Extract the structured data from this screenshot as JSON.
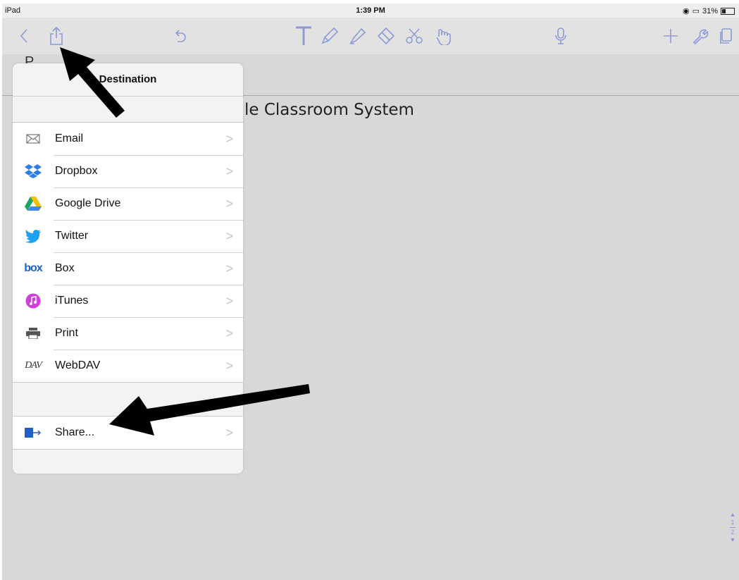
{
  "status_bar": {
    "device": "iPad",
    "time": "1:39 PM",
    "battery": "31%"
  },
  "document": {
    "title_fragment": "le Classroom System",
    "page_letter": "P"
  },
  "popover": {
    "title": "Destination",
    "destinations": [
      {
        "label": "Email",
        "icon": "email-icon"
      },
      {
        "label": "Dropbox",
        "icon": "dropbox-icon"
      },
      {
        "label": "Google Drive",
        "icon": "google-drive-icon"
      },
      {
        "label": "Twitter",
        "icon": "twitter-icon"
      },
      {
        "label": "Box",
        "icon": "box-icon"
      },
      {
        "label": "iTunes",
        "icon": "itunes-icon"
      },
      {
        "label": "Print",
        "icon": "print-icon"
      },
      {
        "label": "WebDAV",
        "icon": "webdav-icon"
      }
    ],
    "share": {
      "label": "Share...",
      "icon": "share-icon"
    },
    "chevron": ">"
  },
  "icon_text": {
    "box": "box",
    "webdav": "DAV"
  },
  "page_indicator": {
    "current": "1",
    "total": "2"
  },
  "colors": {
    "toolbar_icon": "#8e9bd6",
    "dropbox": "#2d7fe2",
    "twitter": "#1da1f2",
    "box": "#1a64c6",
    "itunes": "#d33ddb",
    "share": "#1f5fc4"
  }
}
